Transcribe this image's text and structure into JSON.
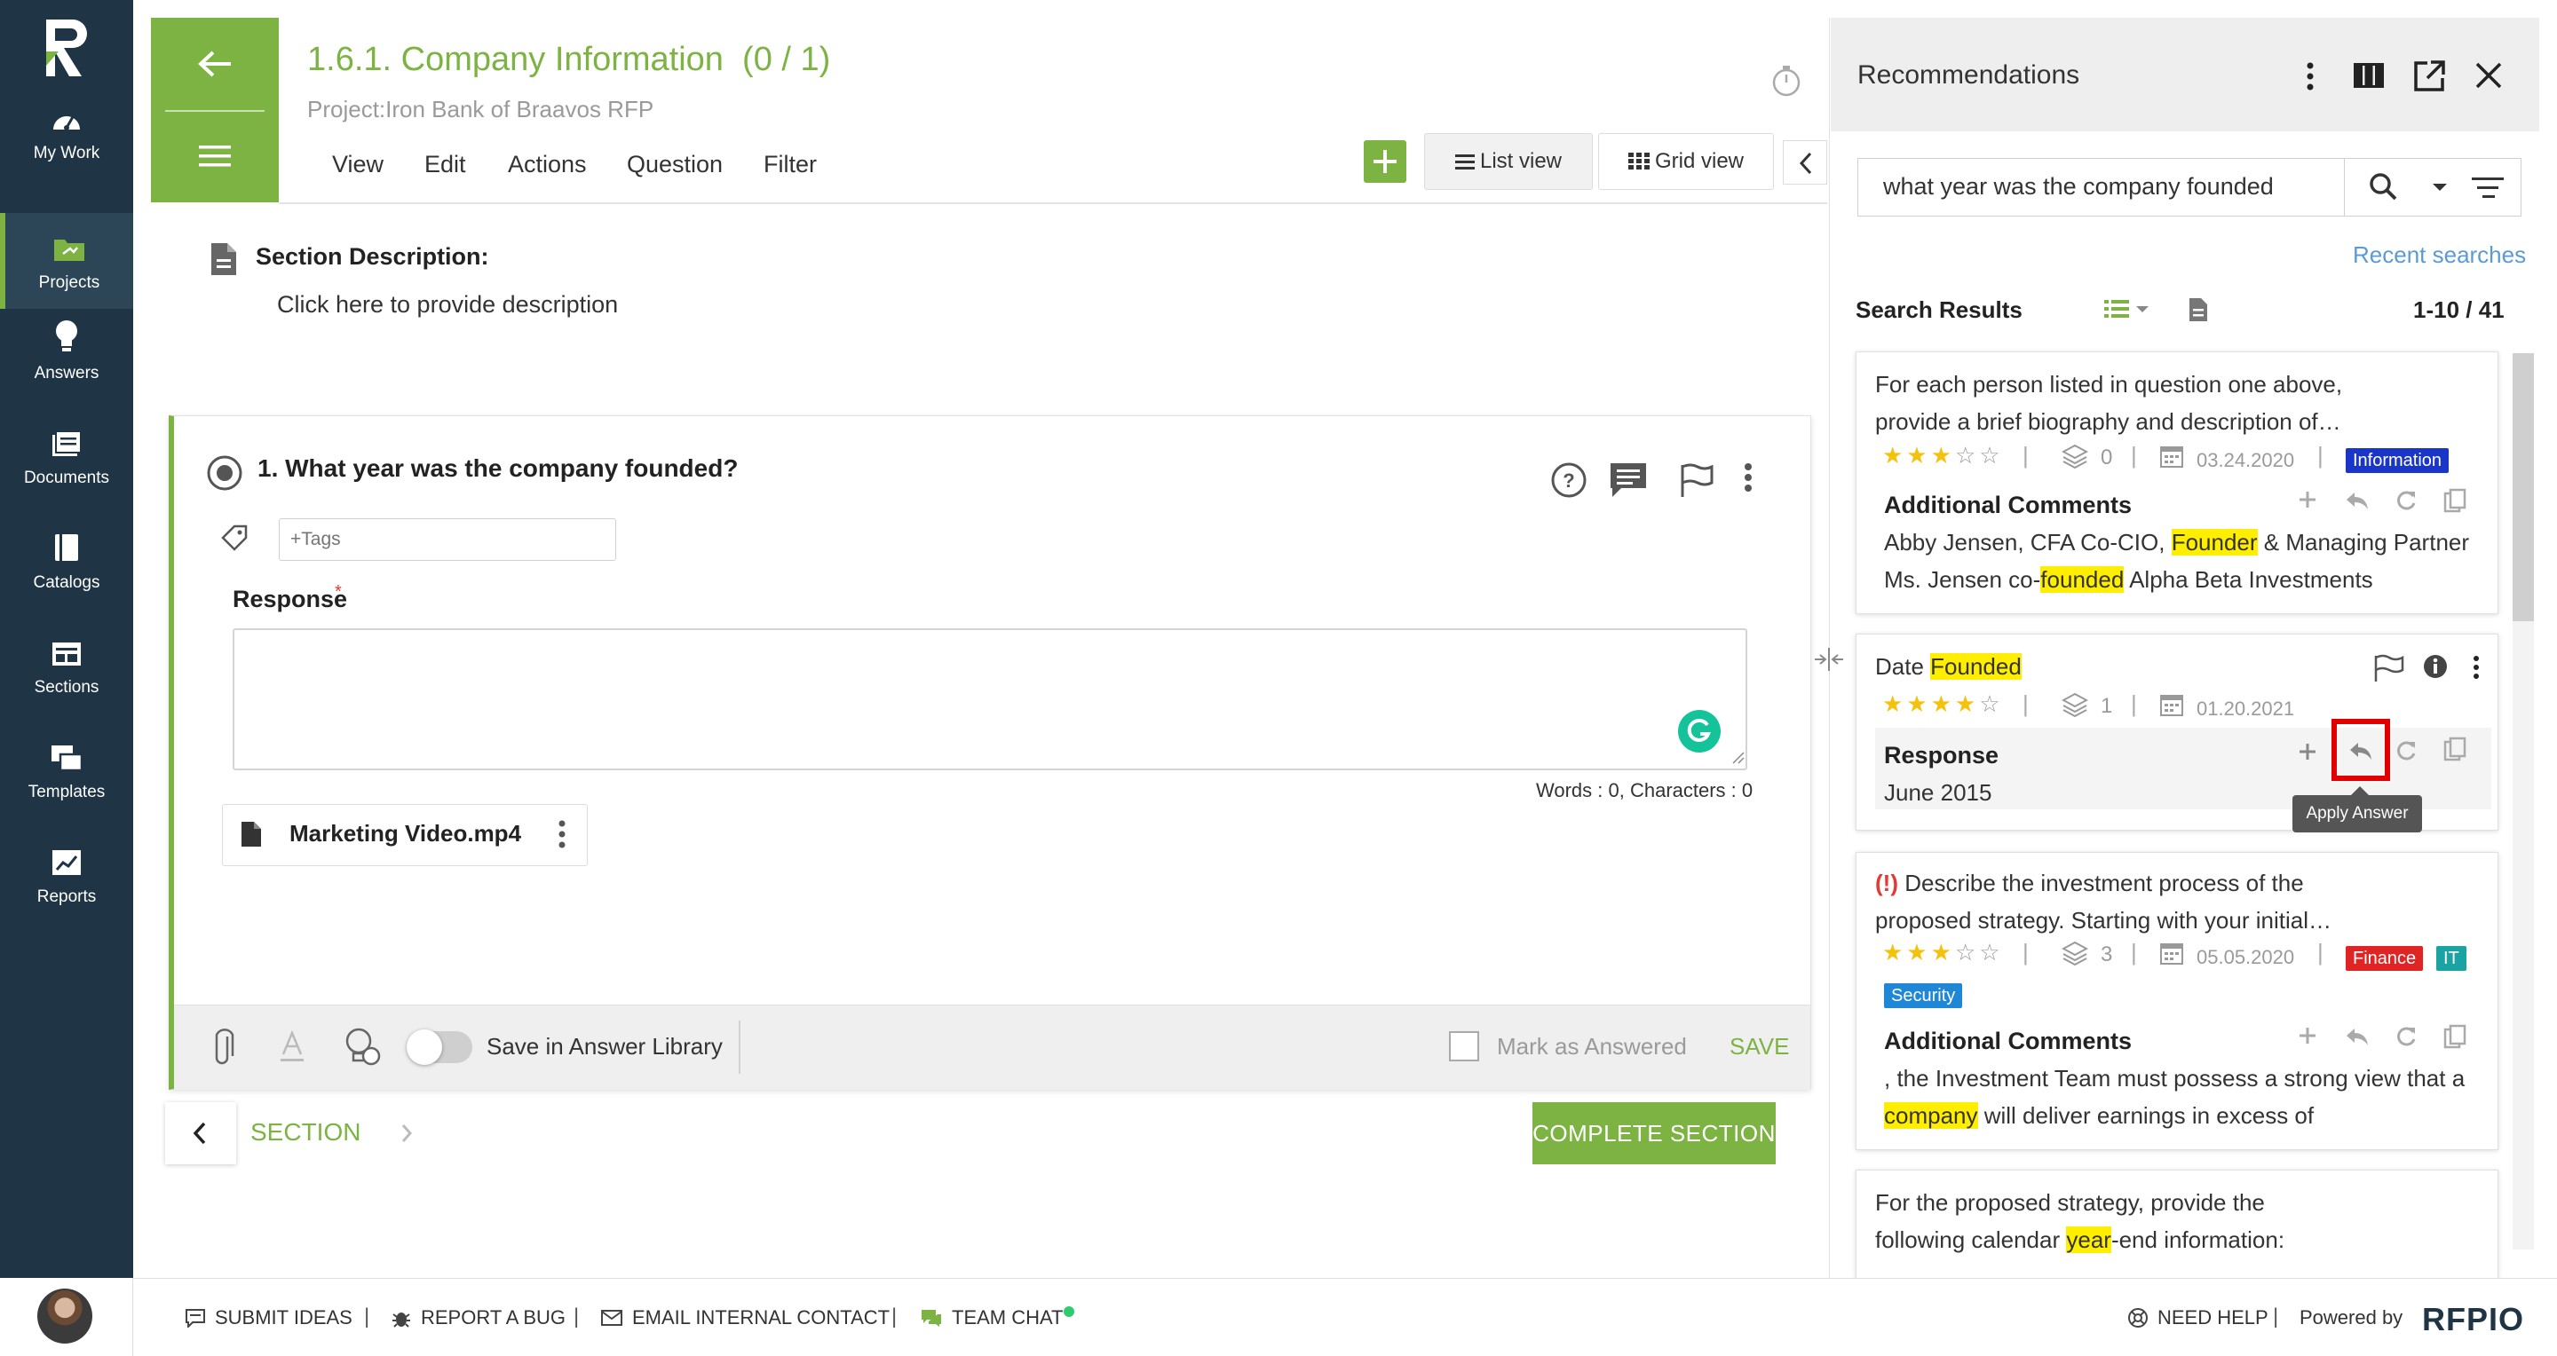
{
  "nav": {
    "items": [
      {
        "label": "My Work",
        "icon": "gauge-icon"
      },
      {
        "label": "Projects",
        "icon": "folder-icon"
      },
      {
        "label": "Answers",
        "icon": "lightbulb-icon"
      },
      {
        "label": "Documents",
        "icon": "documents-icon"
      },
      {
        "label": "Catalogs",
        "icon": "book-icon"
      },
      {
        "label": "Sections",
        "icon": "sections-icon"
      },
      {
        "label": "Templates",
        "icon": "templates-icon"
      },
      {
        "label": "Reports",
        "icon": "chart-icon"
      }
    ],
    "active": "Projects"
  },
  "header": {
    "title": "1.6.1. Company Information",
    "progress": "(0 / 1)",
    "project": "Project:Iron Bank of Braavos RFP",
    "menu": [
      "View",
      "Edit",
      "Actions",
      "Question",
      "Filter"
    ],
    "list_view": "List view",
    "grid_view": "Grid view"
  },
  "section_description": {
    "label": "Section Description:",
    "text": "Click here to provide description"
  },
  "question": {
    "title": "1. What year was the company founded?",
    "tags_placeholder": "+Tags",
    "response_label": "Response",
    "required_mark": "*",
    "word_count": "Words : 0, Characters : 0",
    "attachment": "Marketing Video.mp4",
    "save_in_library": "Save in Answer Library",
    "mark_as_answered": "Mark as Answered",
    "save": "SAVE"
  },
  "section_nav": {
    "label": "SECTION",
    "complete": "COMPLETE SECTION"
  },
  "recommendations": {
    "title": "Recommendations",
    "search_value": "what year was the company founded",
    "recent_searches": "Recent searches",
    "results_label": "Search Results",
    "results_count": "1-10 / 41",
    "apply_tooltip": "Apply Answer",
    "cards": [
      {
        "q_line1": "For each person listed in question one above,",
        "q_line2": "provide a brief biography and description of…",
        "rating": 3,
        "usage": "0",
        "date": "03.24.2020",
        "tags": [
          "Information"
        ],
        "section": "Additional Comments",
        "a_line1_pre": "Abby Jensen, CFA Co-CIO, ",
        "a_line1_hl": "Founder",
        "a_line1_post": " & Managing Partner",
        "a_line2_pre": "Ms. Jensen co-",
        "a_line2_hl": "founded",
        "a_line2_post": " Alpha Beta Investments"
      },
      {
        "q_pre": "Date ",
        "q_hl": "Founded",
        "rating": 4,
        "usage": "1",
        "date": "01.20.2021",
        "section": "Response",
        "answer": "June 2015"
      },
      {
        "alert": "!",
        "q_line1": "Describe the investment process of the",
        "q_line2": "proposed strategy. Starting with your initial…",
        "rating": 3,
        "usage": "3",
        "date": "05.05.2020",
        "tags": [
          "Finance",
          "IT",
          "Security"
        ],
        "section": "Additional Comments",
        "a_line1": ", the Investment Team must possess a strong view that a",
        "a_line2_hl": "company",
        "a_line2_post": " will deliver earnings in excess of"
      },
      {
        "q_line1": "For the proposed strategy, provide the",
        "q_line2_pre": "following calendar ",
        "q_line2_hl": "year",
        "q_line2_post": "-end information:"
      }
    ]
  },
  "bottom_bar": {
    "submit_ideas": "SUBMIT IDEAS",
    "report_bug": "REPORT A BUG",
    "email_contact": "EMAIL INTERNAL CONTACT",
    "team_chat": "TEAM CHAT",
    "need_help": "NEED HELP",
    "powered_by": "Powered by",
    "logo": "RFPIO"
  },
  "colors": {
    "brand_green": "#7cb342",
    "nav_bg": "#1f3445",
    "highlight": "#ffee00",
    "tag_information": "#1a36c9",
    "tag_finance": "#e02424",
    "tag_it": "#1ba3a3",
    "tag_security": "#1f87d6",
    "apply_box": "#e10000"
  }
}
